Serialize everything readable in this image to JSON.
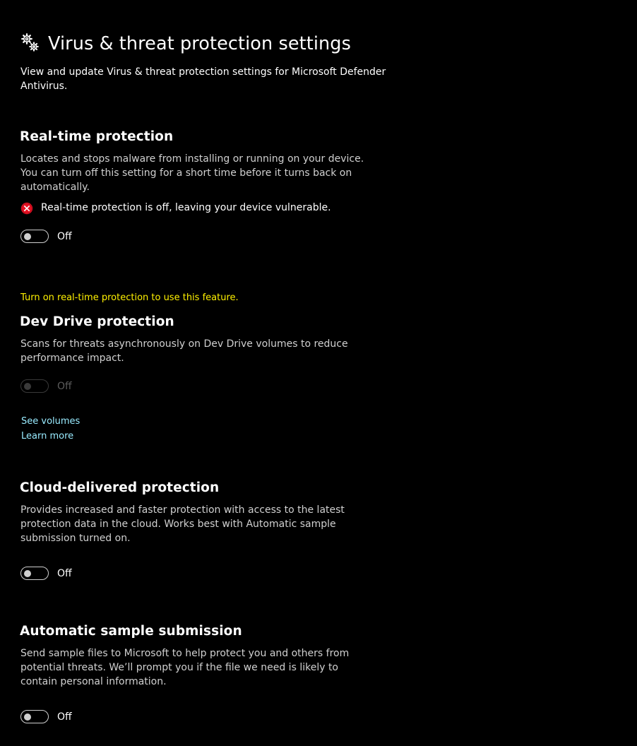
{
  "header": {
    "title": "Virus & threat protection settings",
    "subtitle": "View and update Virus & threat protection settings for Microsoft Defender Antivirus.",
    "icon": "gears-icon"
  },
  "realtime": {
    "title": "Real-time protection",
    "description": "Locates and stops malware from installing or running on your device. You can turn off this setting for a short time before it turns back on automatically.",
    "status_icon": "error-x-icon",
    "status_color": "#e81123",
    "status_text": "Real-time protection is off, leaving your device vulnerable.",
    "toggle_label": "Off",
    "enabled": false
  },
  "devdrive": {
    "warning": "Turn on real-time protection to use this feature.",
    "warning_color": "#fff100",
    "title": "Dev Drive protection",
    "description": "Scans for threats asynchronously on Dev Drive volumes to reduce performance impact.",
    "toggle_label": "Off",
    "enabled": false,
    "disabled": true,
    "link_volumes": "See volumes",
    "link_learn": "Learn more",
    "link_color": "#99ebff"
  },
  "cloud": {
    "title": "Cloud-delivered protection",
    "description": "Provides increased and faster protection with access to the latest protection data in the cloud. Works best with Automatic sample submission turned on.",
    "toggle_label": "Off",
    "enabled": false
  },
  "sample": {
    "title": "Automatic sample submission",
    "description": "Send sample files to Microsoft to help protect you and others from potential threats. We’ll prompt you if the file we need is likely to contain personal information.",
    "toggle_label": "Off",
    "enabled": false
  }
}
